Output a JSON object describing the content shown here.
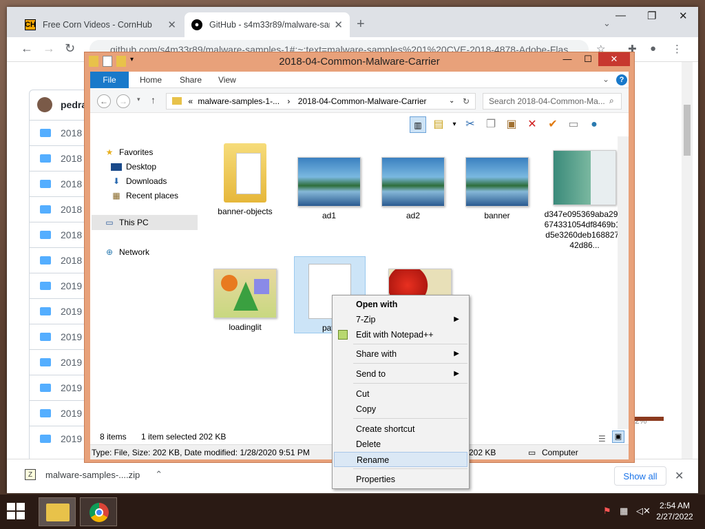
{
  "browser": {
    "tabs": [
      {
        "favicon": "CH",
        "title": "Free Corn Videos - CornHub"
      },
      {
        "favicon": "github-icon",
        "title": "GitHub - s4m33r89/malware-samples"
      }
    ],
    "url": "github.com/s4m33r89/malware-samples-1#:~:text=malware-samples%201%20CVE-2018-4878-Adobe-Flas",
    "sidebar_user": "pedra",
    "file_rows": [
      "2018",
      "2018",
      "2018",
      "2018",
      "2018",
      "2018",
      "2019",
      "2019",
      "2019",
      "2019",
      "2019",
      "2019",
      "2019"
    ],
    "right_text": "2%",
    "download": {
      "name": "malware-samples-....zip",
      "show_all": "Show all"
    }
  },
  "explorer": {
    "title": "2018-04-Common-Malware-Carrier",
    "ribbon_tabs": [
      "File",
      "Home",
      "Share",
      "View"
    ],
    "address": {
      "prefix": "«",
      "crumb1": "malware-samples-1-...",
      "sep": "›",
      "crumb2": "2018-04-Common-Malware-Carrier"
    },
    "search_placeholder": "Search 2018-04-Common-Ma...",
    "nav": {
      "favorites": "Favorites",
      "desktop": "Desktop",
      "downloads": "Downloads",
      "recent": "Recent places",
      "thispc": "This PC",
      "network": "Network"
    },
    "items": [
      {
        "name": "banner-objects",
        "kind": "folder"
      },
      {
        "name": "ad1",
        "kind": "image"
      },
      {
        "name": "ad2",
        "kind": "image"
      },
      {
        "name": "banner",
        "kind": "image"
      },
      {
        "name": "d347e095369aba294f674331054df8469b12d5e3260deb168827142d86...",
        "kind": "document"
      },
      {
        "name": "loadinglit",
        "kind": "image"
      },
      {
        "name": "payl",
        "kind": "file"
      },
      {
        "name": "",
        "kind": "image"
      }
    ],
    "status": {
      "count": "8 items",
      "selected": "1 item selected",
      "size": "202 KB"
    },
    "details": {
      "info": "Type: File, Size: 202 KB, Date modified: 1/28/2020 9:51 PM",
      "size": "202 KB",
      "location": "Computer"
    }
  },
  "context_menu": {
    "items": [
      "Open with",
      "7-Zip",
      "Edit with Notepad++",
      "Share with",
      "Send to",
      "Cut",
      "Copy",
      "Create shortcut",
      "Delete",
      "Rename",
      "Properties"
    ],
    "highlighted": "Rename"
  },
  "taskbar": {
    "time": "2:54 AM",
    "date": "2/27/2022"
  },
  "colors": {
    "accent": "#1979ca",
    "explorer_border": "#e8a17a",
    "close": "#c7382f"
  }
}
